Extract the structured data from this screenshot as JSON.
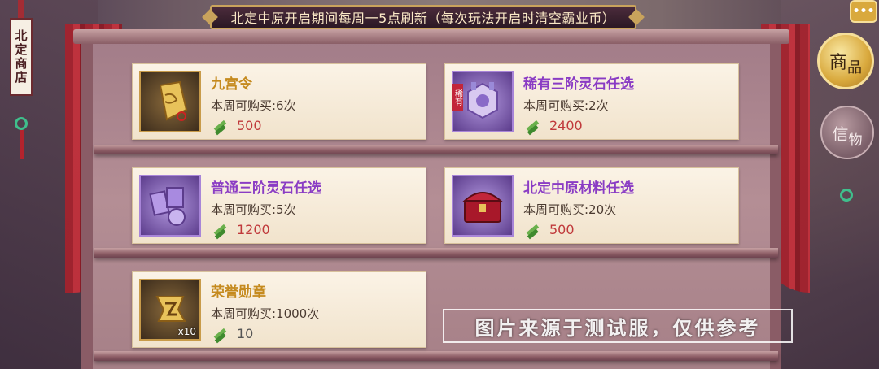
{
  "banner": {
    "text": "北定中原开启期间每周一5点刷新（每次玩法开启时清空霸业币）"
  },
  "store_sign": {
    "label": "北定商店"
  },
  "tabs": {
    "goods_1": "商",
    "goods_2": "品",
    "token_1": "信",
    "token_2": "物"
  },
  "chat_icon": "chat-icon",
  "colors": {
    "name_gold": "#c58a1e",
    "name_purple": "#8a3cc4",
    "price_red": "#c0393b",
    "price_gray": "#555555"
  },
  "items": [
    {
      "name": "九宫令",
      "limit": "本周可购买:6次",
      "price": "500",
      "rarity": "gold",
      "icon": "token-plaque-icon"
    },
    {
      "name": "稀有三阶灵石任选",
      "limit": "本周可购买:2次",
      "price": "2400",
      "rarity": "purple",
      "icon": "spirit-stone-box-icon",
      "tag": "稀有"
    },
    {
      "name": "普通三阶灵石任选",
      "limit": "本周可购买:5次",
      "price": "1200",
      "rarity": "purple",
      "icon": "spirit-stone-cards-icon"
    },
    {
      "name": "北定中原材料任选",
      "limit": "本周可购买:20次",
      "price": "500",
      "rarity": "purple",
      "icon": "treasure-chest-icon"
    },
    {
      "name": "荣誉勋章",
      "limit": "本周可购买:1000次",
      "price": "10",
      "rarity": "gold",
      "icon": "honor-medal-icon",
      "qty": "x10"
    }
  ],
  "watermark": "图片来源于测试服，仅供参考"
}
